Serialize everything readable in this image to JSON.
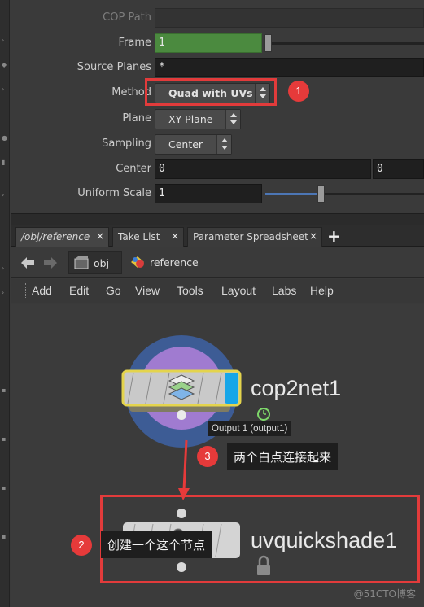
{
  "params": {
    "cop_path_label": "COP Path",
    "frame_label": "Frame",
    "frame_value": "1",
    "source_planes_label": "Source Planes",
    "source_planes_value": "*",
    "method_label": "Method",
    "method_value": "Quad with UVs",
    "plane_label": "Plane",
    "plane_value": "XY Plane",
    "sampling_label": "Sampling",
    "sampling_value": "Center",
    "center_label": "Center",
    "center_x": "0",
    "center_y": "0",
    "uniform_scale_label": "Uniform Scale",
    "uniform_scale_value": "1"
  },
  "tabs": [
    {
      "label": "/obj/reference",
      "close": "×"
    },
    {
      "label": "Take List",
      "close": "×"
    },
    {
      "label": "Parameter Spreadsheet",
      "close": "×"
    }
  ],
  "tab_add": "+",
  "path": {
    "obj": "obj",
    "reference": "reference"
  },
  "menu": [
    "Add",
    "Edit",
    "Go",
    "View",
    "Tools",
    "Layout",
    "Labs",
    "Help"
  ],
  "network": {
    "node1_name": "cop2net1",
    "node1_tooltip": "Output 1 (output1)",
    "node2_name": "uvquickshade1"
  },
  "annotations": {
    "badge1": "1",
    "badge2": "2",
    "badge3": "3",
    "callout2": "创建一个这个节点",
    "callout3": "两个白点连接起来"
  },
  "watermark": "@51CTO博客",
  "colors": {
    "highlight_red": "#e23b3b",
    "frame_green": "#4b8a3f",
    "slider_blue": "#4c76b5",
    "node_blue_ring": "#3f5f9c",
    "node_purple": "#9b6fcf",
    "node_yellow_border": "#d8c94a",
    "node_cyan_flag": "#1aa8e6"
  }
}
